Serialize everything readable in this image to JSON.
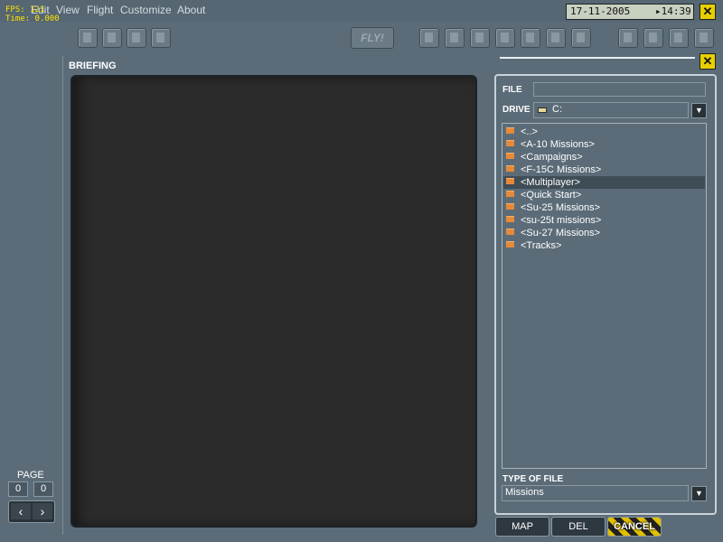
{
  "menu": {
    "items": [
      "Edit",
      "View",
      "Flight",
      "Customize",
      "About"
    ],
    "fps_line": "FPS: 121",
    "time_line": "Time: 0.000"
  },
  "clock": {
    "date": "17-11-2005",
    "time": "▸14:39"
  },
  "close_glyph": "✕",
  "toolbar": {
    "fly_label": "FLY!"
  },
  "briefing": {
    "title": "BRIEFING"
  },
  "page": {
    "label": "PAGE",
    "current": "0",
    "total": "0",
    "prev": "‹",
    "next": "›"
  },
  "panel": {
    "file_label": "FILE",
    "file_value": "",
    "drive_label": "DRIVE",
    "drive_value": "C:",
    "dropdown_glyph": "▼",
    "files": [
      "<..>",
      "<A-10 Missions>",
      "<Campaigns>",
      "<F-15C Missions>",
      "<Multiplayer>",
      "<Quick Start>",
      "<Su-25 Missions>",
      "<su-25t missions>",
      "<Su-27 Missions>",
      "<Tracks>"
    ],
    "selected_index": 4,
    "type_label": "TYPE OF FILE",
    "type_value": "Missions"
  },
  "buttons": {
    "map": "MAP",
    "del": "DEL",
    "cancel": "CANCEL"
  },
  "colors": {
    "accent": "#e8d000",
    "folder": "#e58a3a",
    "background": "#5b6c78"
  }
}
